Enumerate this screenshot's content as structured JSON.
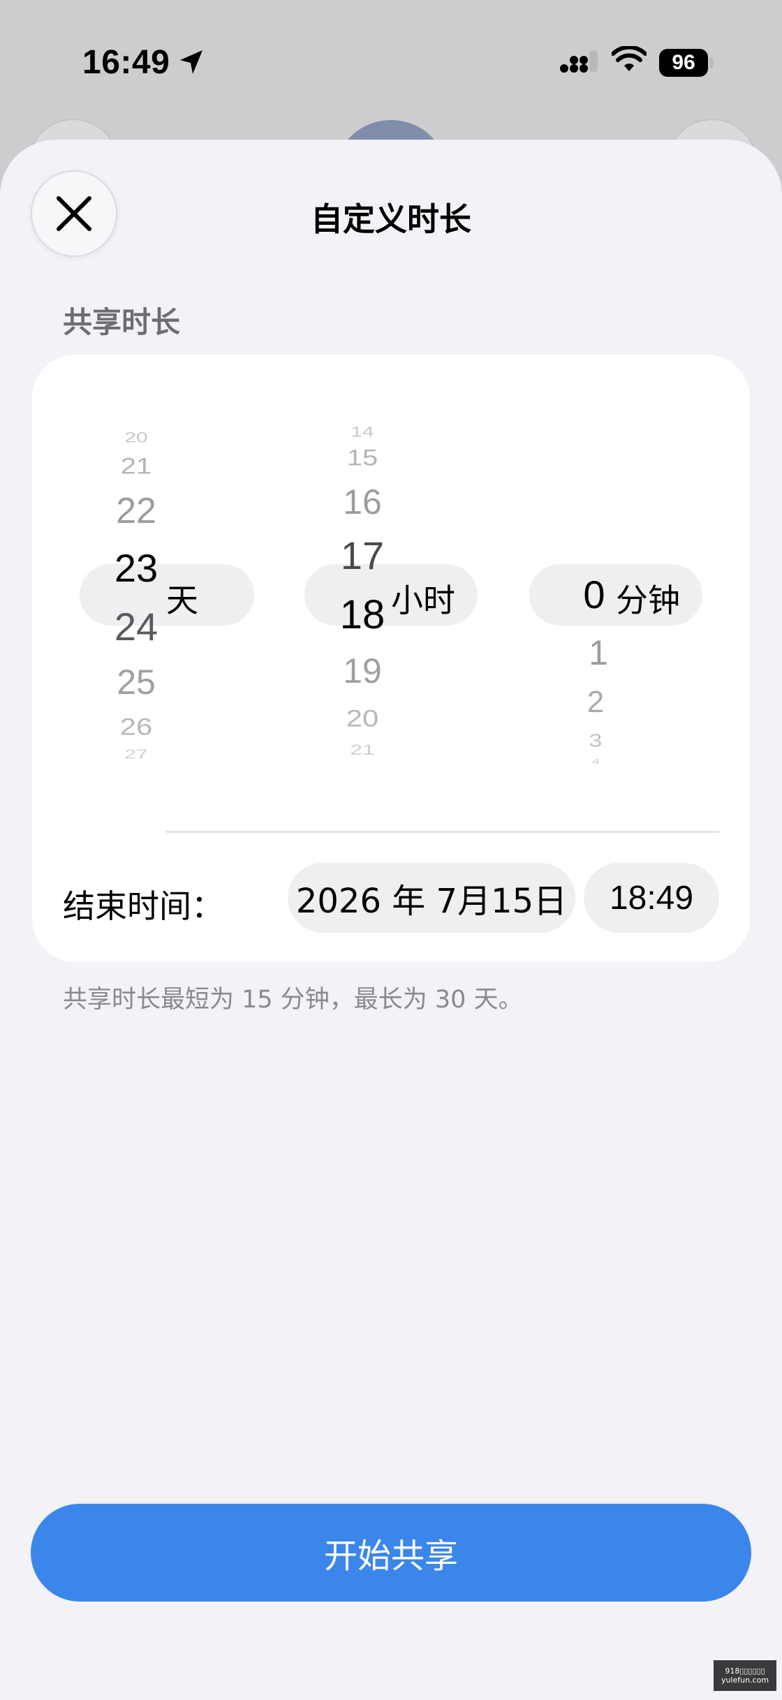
{
  "status_bar": {
    "time": "16:49",
    "battery": "96",
    "icons": [
      "location-arrow-icon",
      "cellular-signal-icon",
      "wifi-icon",
      "battery-icon"
    ]
  },
  "sheet": {
    "title": "自定义时长",
    "section_label": "共享时长"
  },
  "picker": {
    "days": {
      "above": [
        "20",
        "21",
        "22",
        "23"
      ],
      "selected": "24",
      "below": [
        "25",
        "26",
        "27"
      ],
      "unit": "天"
    },
    "hours": {
      "above": [
        "14",
        "15",
        "16",
        "17"
      ],
      "selected": "18",
      "below": [
        "19",
        "20",
        "21"
      ],
      "unit": "小时"
    },
    "minutes": {
      "above": [],
      "selected": "0",
      "below": [
        "1",
        "2",
        "3",
        "4"
      ],
      "unit": "分钟"
    }
  },
  "end_time": {
    "label": "结束时间：",
    "date": "2026 年 7月15日",
    "time": "18:49"
  },
  "hint": "共享时长最短为 15 分钟，最长为 30 天。",
  "start_button": "开始共享",
  "watermark": {
    "line1": "918▯▯▯▯▯▯",
    "line2": "yulefun.com"
  },
  "colors": {
    "accent": "#3b86ea",
    "sheet_bg": "#f2f2f7",
    "card_bg": "#ffffff",
    "pill_bg": "#efeff2",
    "secondary_text": "#8a8a8e"
  }
}
